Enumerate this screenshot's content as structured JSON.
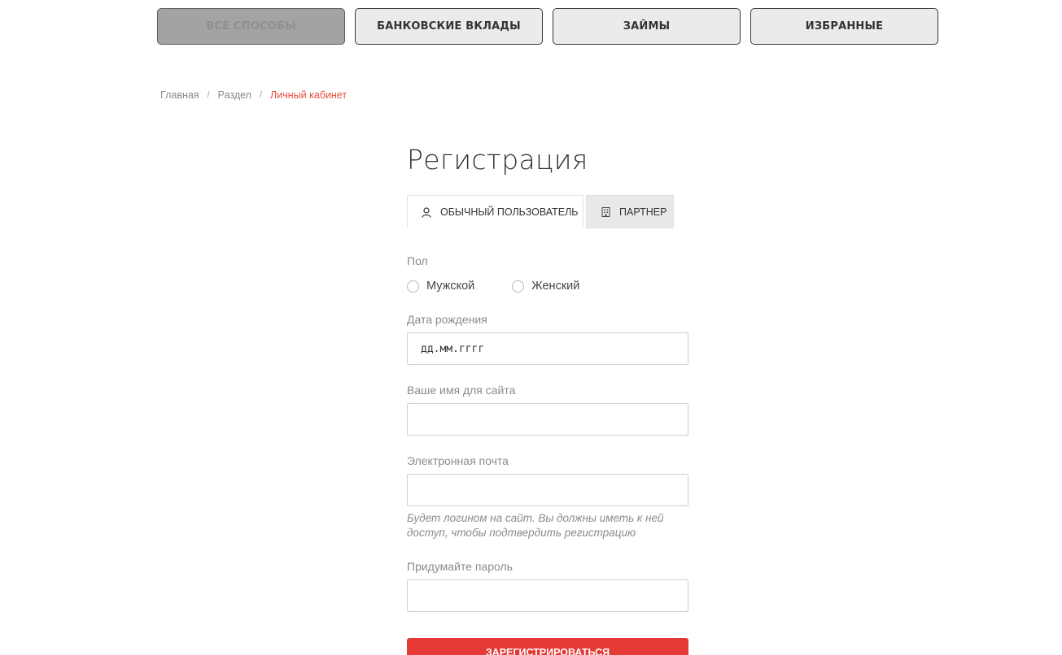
{
  "top_nav": {
    "items": [
      {
        "label": "ВСЕ СПОСОБЫ",
        "active": true
      },
      {
        "label": "БАНКОВСКИЕ ВКЛАДЫ",
        "active": false
      },
      {
        "label": "ЗАЙМЫ",
        "active": false
      },
      {
        "label": "ИЗБРАННЫЕ",
        "active": false
      }
    ]
  },
  "breadcrumb": {
    "items": [
      "Главная",
      "Раздел"
    ],
    "separator": "/",
    "current": "Личный кабинет"
  },
  "registration": {
    "title": "Регистрация",
    "tabs": [
      {
        "label": "ОБЫЧНЫЙ ПОЛЬЗОВАТЕЛЬ",
        "icon": "user-icon",
        "active": true
      },
      {
        "label": "ПАРТНЕР",
        "icon": "building-icon",
        "active": false
      }
    ],
    "gender": {
      "label": "Пол",
      "options": [
        "Мужской",
        "Женский"
      ]
    },
    "dob": {
      "label": "Дата рождения",
      "placeholder": "дд.мм.гггг"
    },
    "name": {
      "label": "Ваше имя для сайта",
      "value": ""
    },
    "email": {
      "label": "Электронная почта",
      "value": "",
      "hint": "Будет логином на сайт. Вы должны иметь к ней доступ, чтобы подтвердить регистрацию"
    },
    "password": {
      "label": "Придумайте пароль",
      "value": ""
    },
    "submit_label": "ЗАРЕГИСТРИРОВАТЬСЯ"
  },
  "colors": {
    "accent": "#e53935",
    "breadcrumb_current": "#e74c3c",
    "nav_active_bg": "#a3a3a4",
    "nav_bg": "#ebebeb"
  }
}
